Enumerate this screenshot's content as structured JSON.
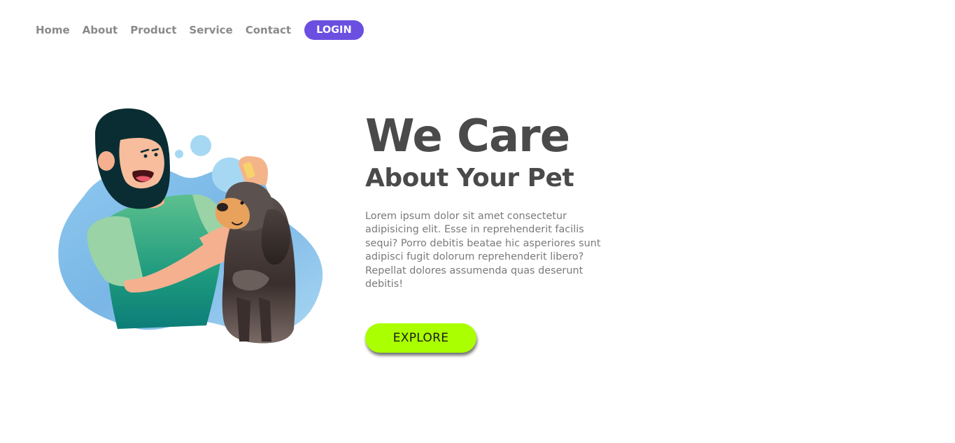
{
  "nav": {
    "links": [
      {
        "label": "Home"
      },
      {
        "label": "About"
      },
      {
        "label": "Product"
      },
      {
        "label": "Service"
      },
      {
        "label": "Contact"
      }
    ],
    "login_label": "LOGIN"
  },
  "hero": {
    "title": "We Care",
    "subtitle": "About Your Pet",
    "text": "Lorem ipsum dolor sit amet consectetur adipisicing elit. Esse in reprehenderit facilis sequi? Porro debitis beatae hic asperiores sunt adipisci fugit dolorum reprehenderit libero? Repellat dolores assumenda quas deserunt debitis!",
    "cta_label": "EXPLORE"
  },
  "colors": {
    "accent": "#6a4fe0",
    "cta": "#aaff00",
    "heading": "#4a4a4a",
    "nav_text": "#8a8a8a"
  },
  "illustration": {
    "description_icon": "woman-grooming-dog-illustration"
  }
}
